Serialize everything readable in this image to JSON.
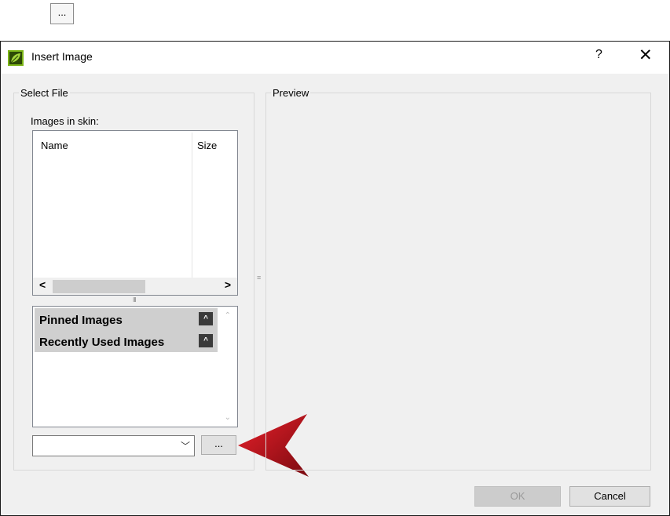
{
  "top_browse_label": "...",
  "dialog": {
    "title": "Insert Image",
    "help_label": "?",
    "close_label": "✕"
  },
  "select_file": {
    "group_title": "Select File",
    "images_label": "Images in skin:",
    "columns": [
      "Name",
      "Size"
    ],
    "scroll_left": "<",
    "scroll_right": ">",
    "splitter_grip": "III",
    "collections": [
      {
        "label": "Pinned Images",
        "collapse": "^"
      },
      {
        "label": "Recently Used Images",
        "collapse": "^"
      }
    ],
    "path_value": "",
    "combo_arrow": "﹀",
    "browse_label": "..."
  },
  "preview": {
    "group_title": "Preview",
    "splitter_grip": "≡"
  },
  "buttons": {
    "ok_label": "OK",
    "cancel_label": "Cancel"
  },
  "colors": {
    "dialog_bg": "#f0f0f0",
    "app_icon_green": "#7cb518",
    "pointer_red": "#c0141c"
  }
}
